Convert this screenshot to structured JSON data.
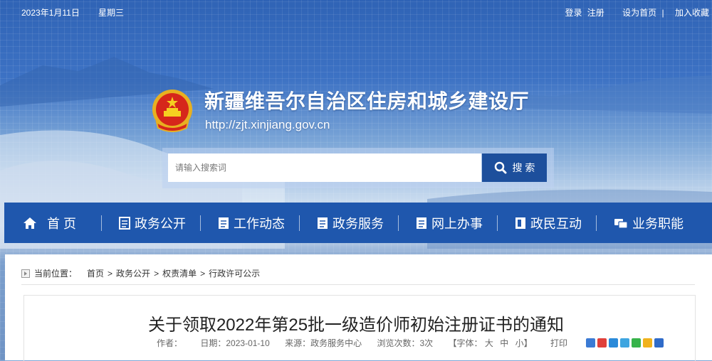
{
  "topbar": {
    "date": "2023年1月11日",
    "weekday": "星期三",
    "login": "登录",
    "register": "注册",
    "set_home": "设为首页",
    "separator": "|",
    "bookmark": "加入收藏"
  },
  "header": {
    "title": "新疆维吾尔自治区住房和城乡建设厅",
    "url": "http://zjt.xinjiang.gov.cn"
  },
  "search": {
    "placeholder": "请输入搜索词",
    "button_label": "搜 索"
  },
  "nav": {
    "items": [
      {
        "label": "首  页",
        "icon": "home-icon"
      },
      {
        "label": "政务公开",
        "icon": "document-icon"
      },
      {
        "label": "工作动态",
        "icon": "document-icon"
      },
      {
        "label": "政务服务",
        "icon": "document-icon"
      },
      {
        "label": "网上办事",
        "icon": "document-icon"
      },
      {
        "label": "政民互动",
        "icon": "document-icon"
      },
      {
        "label": "业务职能",
        "icon": "chat-icon"
      }
    ]
  },
  "breadcrumb": {
    "prefix": "当前位置：",
    "items": [
      "首页",
      "政务公开",
      "权责清单",
      "行政许可公示"
    ],
    "arrow": ">"
  },
  "article": {
    "title": "关于领取2022年第25批一级造价师初始注册证书的通知",
    "author_label": "作者：",
    "date_label": "日期：",
    "date": "2023-01-10",
    "source_label": "来源：",
    "source": "政务服务中心",
    "views_label": "浏览次数：",
    "views": "3次",
    "font_label": "【字体：",
    "font_large": "大",
    "font_medium": "中",
    "font_small": "小",
    "font_close": "】",
    "print": "打印"
  },
  "colors": {
    "nav_bg": "#1f57ad",
    "search_button": "#1d4f9c"
  }
}
